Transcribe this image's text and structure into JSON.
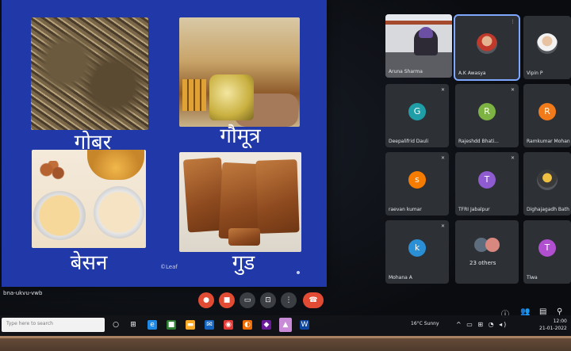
{
  "slide": {
    "captions": {
      "gobar": "गोबर",
      "gaumutra": "गौमूत्र",
      "besan": "बेसन",
      "gud": "गुड"
    },
    "credit": "©Leaf"
  },
  "participants": [
    {
      "name": "Aruna Sharma",
      "type": "video"
    },
    {
      "name": "A.K Awasya",
      "type": "photo",
      "selected": true
    },
    {
      "name": "Vipin P",
      "type": "photo"
    },
    {
      "name": "Deepalifrid Dauli",
      "initial": "G",
      "color": "#1f9ea8"
    },
    {
      "name": "Rajeshdd Bhati...",
      "initial": "R",
      "color": "#7cb342"
    },
    {
      "name": "Ramkumar Mohan",
      "initial": "R",
      "color": "#f17a1a"
    },
    {
      "name": "raevan kumar",
      "initial": "s",
      "color": "#f57c00"
    },
    {
      "name": "TFRI Jabalpur",
      "initial": "T",
      "color": "#8e5bd0"
    },
    {
      "name": "Dighajagadh Bath",
      "type": "photo"
    },
    {
      "name": "Mohana A",
      "initial": "k",
      "color": "#2b8fd6"
    },
    {
      "name": "23 others",
      "type": "group"
    },
    {
      "name": "Tiwa",
      "initial": "T",
      "color": "#b04fd0"
    }
  ],
  "controls": {
    "mic_icon": "mic-off-icon",
    "camera_icon": "camera-off-icon",
    "captions_icon": "captions-icon",
    "present_icon": "present-icon",
    "more_icon": "more-icon",
    "end_icon": "end-call-icon"
  },
  "meeting_url": "bna-ukvu-vwb",
  "taskbar": {
    "search_placeholder": "Type here to search",
    "weather": "16°C Sunny",
    "time": "12:00",
    "date": "21-01-2022"
  }
}
